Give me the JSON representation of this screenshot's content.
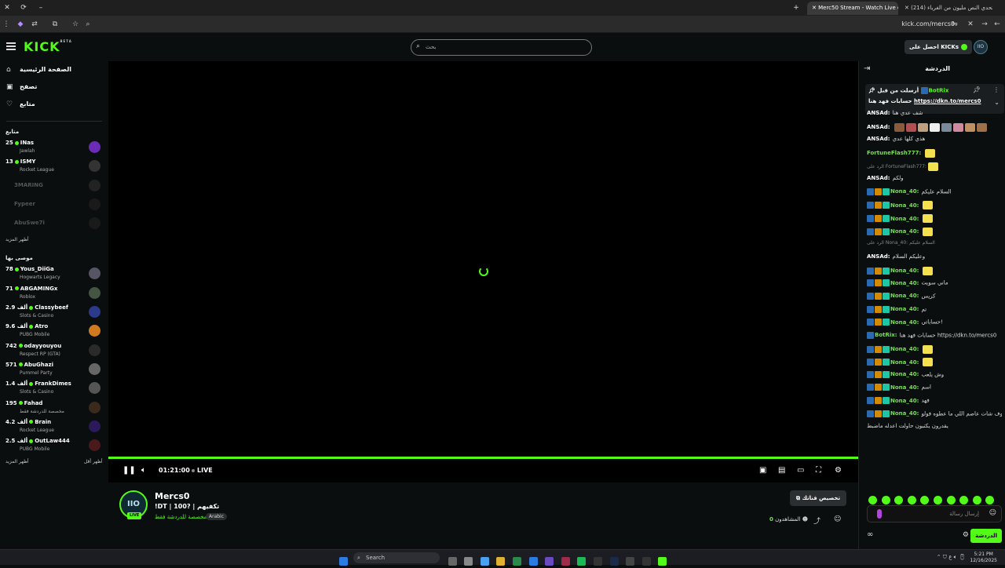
{
  "browser": {
    "tabs": [
      {
        "title": "Merc50 Stream - Watch Live on",
        "active": true
      },
      {
        "title": "(214) تحدي النص مليون من الغرباء",
        "active": false
      }
    ],
    "url": "kick.com/mercs0"
  },
  "header": {
    "logo": "KICK",
    "logo_badge": "BETA",
    "search_placeholder": "بحث",
    "get_kicks": "احصل على KICKs",
    "avatar_text": "IIO"
  },
  "sidebar": {
    "nav": [
      {
        "label": "الصفحة الرئيسية",
        "icon": "home-icon"
      },
      {
        "label": "تصفح",
        "icon": "browse-icon"
      },
      {
        "label": "متابع",
        "icon": "heart-icon"
      }
    ],
    "following_title": "متابع",
    "following": [
      {
        "viewers": "25",
        "name": "INas",
        "category": "Jawlah",
        "online": true,
        "avatar_color": "#6b2bb8"
      },
      {
        "viewers": "13",
        "name": "ISMY",
        "category": "Rocket League",
        "online": true,
        "avatar_color": "#333"
      },
      {
        "viewers": "",
        "name": "3MARING",
        "category": "",
        "online": false,
        "avatar_color": "#222"
      },
      {
        "viewers": "",
        "name": "Fypeer",
        "category": "",
        "online": false,
        "avatar_color": "#1a1a1a"
      },
      {
        "viewers": "",
        "name": "AbuSwe7i",
        "category": "",
        "online": false,
        "avatar_color": "#1a1a1a"
      }
    ],
    "show_more_following": "أظهر المزيد",
    "recommended_title": "موصى بها",
    "recommended": [
      {
        "viewers": "78",
        "name": "Yous_DiiGa",
        "category": "Hogwarts Legacy",
        "avatar_color": "#556"
      },
      {
        "viewers": "71",
        "name": "ABGAMINGx",
        "category": "Roblox",
        "avatar_color": "#454"
      },
      {
        "viewers": "2.9 ألف",
        "name": "Classybeef",
        "category": "Slots & Casino",
        "avatar_color": "#2b3a8a"
      },
      {
        "viewers": "9.6 ألف",
        "name": "Atro",
        "category": "PUBG Mobile",
        "avatar_color": "#d07a20"
      },
      {
        "viewers": "742",
        "name": "odayyouyou",
        "category": "Respect RP (GTA)",
        "avatar_color": "#2a2a2a"
      },
      {
        "viewers": "571",
        "name": "AbuGhazi",
        "category": "Pummel Party",
        "avatar_color": "#666"
      },
      {
        "viewers": "1.4 ألف",
        "name": "FrankDimes",
        "category": "Slots & Casino",
        "avatar_color": "#555"
      },
      {
        "viewers": "195",
        "name": "Fahad",
        "category": "مخصصة للدردشة فقط",
        "avatar_color": "#3a2a1a"
      },
      {
        "viewers": "4.2 ألف",
        "name": "Brain",
        "category": "Rocket League",
        "avatar_color": "#2a1a5a"
      },
      {
        "viewers": "2.5 ألف",
        "name": "OutLaw444",
        "category": "PUBG Mobile",
        "avatar_color": "#4a1a1a"
      }
    ],
    "show_more": "أظهر المزيد",
    "show_less": "أظهر أقل"
  },
  "player": {
    "time": "01:21:00",
    "live_label": "LIVE"
  },
  "channel": {
    "avatar_text": "IIO",
    "live_badge": "LIVE",
    "name": "Mercs0",
    "title": "!DT | 100? | تكفيهم",
    "category": "مخصصة للدردشة فقط",
    "language": "Arabic",
    "customize_button": "تخصيص قناتك",
    "viewers_label": "المشاهدون",
    "viewers_count": "0"
  },
  "chat": {
    "title": "الدردشة",
    "pinned": {
      "label": "أرسلت من قبل",
      "user": "BotRix",
      "text": "حسابات فهد هنا",
      "link": "https://dkn.to/mercs0"
    },
    "messages": [
      {
        "user": "ANSAd",
        "color": "#ffffff",
        "text": "شف عدي هنا",
        "badges": 0,
        "emotes": 0
      },
      {
        "user": "ANSAd",
        "color": "#ffffff",
        "text": "",
        "badges": 0,
        "emotes": 8
      },
      {
        "user": "ANSAd",
        "color": "#ffffff",
        "text": "هذي كلها عدي",
        "badges": 0,
        "emotes": 0
      },
      {
        "user": "FortuneFlash777",
        "color": "#7bdc5a",
        "text": "",
        "badges": 0,
        "emotes": 1
      },
      {
        "user": "",
        "color": "#888888",
        "text": "الرد على FortuneFlash777:",
        "badges": 0,
        "emotes": 1,
        "reply": true
      },
      {
        "user": "ANSAd",
        "color": "#ffffff",
        "text": "ولكم",
        "badges": 0,
        "emotes": 0
      },
      {
        "user": "Nona_40",
        "color": "#7bdc5a",
        "text": "السلام عليكم",
        "badges": 3,
        "emotes": 0
      },
      {
        "user": "Nona_40",
        "color": "#7bdc5a",
        "text": "",
        "badges": 3,
        "emotes": 1
      },
      {
        "user": "Nona_40",
        "color": "#7bdc5a",
        "text": "",
        "badges": 3,
        "emotes": 1
      },
      {
        "user": "Nona_40",
        "color": "#7bdc5a",
        "text": "",
        "badges": 3,
        "emotes": 1
      },
      {
        "user": "",
        "color": "#888888",
        "text": "الرد على Nona_40: السلام عليكم",
        "badges": 0,
        "emotes": 0,
        "reply": true
      },
      {
        "user": "ANSAd",
        "color": "#ffffff",
        "text": "وعليكم السلام",
        "badges": 0,
        "emotes": 0
      },
      {
        "user": "Nona_40",
        "color": "#7bdc5a",
        "text": "",
        "badges": 3,
        "emotes": 1
      },
      {
        "user": "Nona_40",
        "color": "#7bdc5a",
        "text": "ماني سويت",
        "badges": 3,
        "emotes": 0
      },
      {
        "user": "Nona_40",
        "color": "#7bdc5a",
        "text": "كريس",
        "badges": 3,
        "emotes": 0
      },
      {
        "user": "Nona_40",
        "color": "#7bdc5a",
        "text": "تم",
        "badges": 3,
        "emotes": 0
      },
      {
        "user": "Nona_40",
        "color": "#7bdc5a",
        "text": "حساباتي!",
        "badges": 3,
        "emotes": 0
      },
      {
        "user": "BotRix",
        "color": "#7bdc5a",
        "text": "حسابات فهد هنا https://dkn.to/mercs0",
        "badges": 1,
        "emotes": 0
      },
      {
        "user": "Nona_40",
        "color": "#7bdc5a",
        "text": "",
        "badges": 3,
        "emotes": 1
      },
      {
        "user": "Nona_40",
        "color": "#7bdc5a",
        "text": "",
        "badges": 3,
        "emotes": 1
      },
      {
        "user": "Nona_40",
        "color": "#7bdc5a",
        "text": "وش يلعب",
        "badges": 3,
        "emotes": 0
      },
      {
        "user": "Nona_40",
        "color": "#7bdc5a",
        "text": "اسم",
        "badges": 3,
        "emotes": 0
      },
      {
        "user": "Nona_40",
        "color": "#7bdc5a",
        "text": "فهد",
        "badges": 3,
        "emotes": 0
      },
      {
        "user": "Nona_40",
        "color": "#7bdc5a",
        "text": "شوف شات عاصم اللي ما عطوه فولو",
        "badges": 3,
        "emotes": 0
      },
      {
        "user": "",
        "color": "#dddddd",
        "text": "يقدرون يكتبون حاولت اعدله ماضبط",
        "badges": 0,
        "emotes": 0
      }
    ],
    "input_placeholder": "إرسال رسالة",
    "send_button": "الدردشة"
  },
  "taskbar": {
    "search": "Search",
    "time": "5:21 PM",
    "date": "12/16/2025"
  }
}
